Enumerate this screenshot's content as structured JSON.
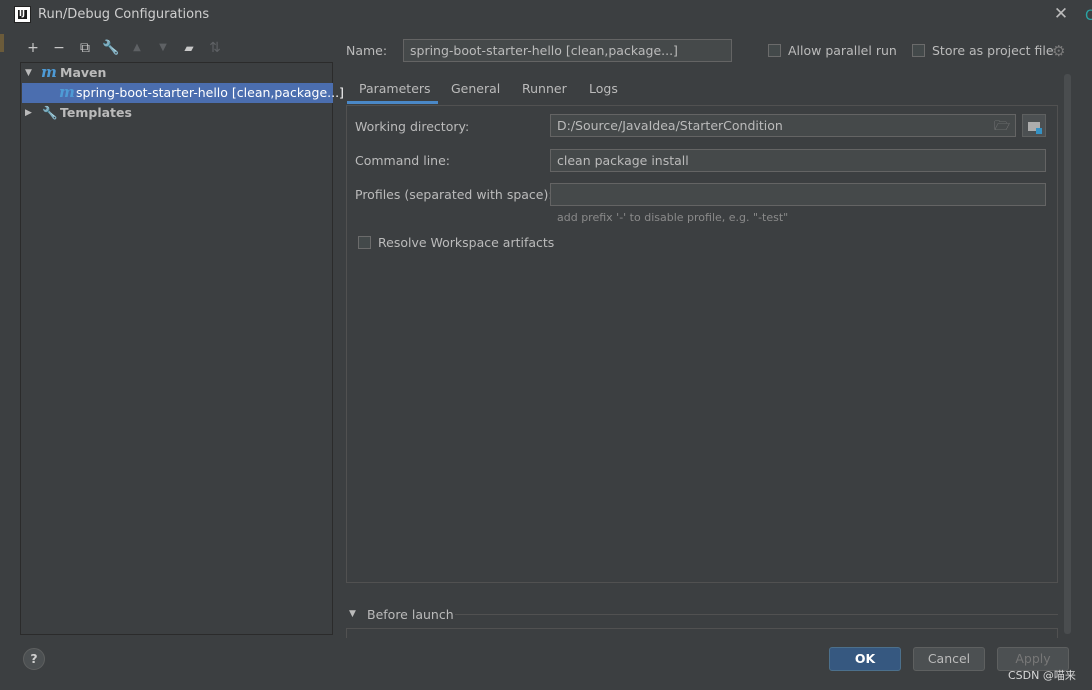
{
  "window": {
    "title": "Run/Debug Configurations",
    "app_icon_text": "IJ"
  },
  "toolbar": {
    "buttons": [
      {
        "name": "add",
        "glyph": "+"
      },
      {
        "name": "remove",
        "glyph": "−"
      },
      {
        "name": "copy",
        "glyph": "⧉"
      },
      {
        "name": "edit-defaults",
        "glyph": "🔧"
      },
      {
        "name": "move-up",
        "glyph": "▲"
      },
      {
        "name": "move-down",
        "glyph": "▼"
      },
      {
        "name": "new-folder",
        "glyph": "▰"
      },
      {
        "name": "sort",
        "glyph": "⇅"
      }
    ]
  },
  "tree": {
    "maven": {
      "label": "Maven",
      "icon": "m"
    },
    "config": {
      "label": "spring-boot-starter-hello [clean,package...]",
      "icon": "m"
    },
    "templates": {
      "label": "Templates"
    }
  },
  "form": {
    "name_label": "Name:",
    "name_value": "spring-boot-starter-hello [clean,package...]",
    "allow_parallel": "Allow parallel run",
    "store_project": "Store as project file",
    "tabs": [
      "Parameters",
      "General",
      "Runner",
      "Logs"
    ],
    "active_tab": "Parameters",
    "working_dir_label": "Working directory:",
    "working_dir_value": "D:/Source/JavaIdea/StarterCondition",
    "command_line_label": "Command line:",
    "command_line_value": "clean package install",
    "profiles_label": "Profiles (separated with space):",
    "profiles_value": "",
    "profiles_hint": "add prefix '-' to disable profile, e.g. \"-test\"",
    "resolve_workspace": "Resolve Workspace artifacts",
    "before_launch": "Before launch"
  },
  "buttons": {
    "ok": "OK",
    "cancel": "Cancel",
    "apply": "Apply",
    "help": "?"
  },
  "watermark": "CSDN @喵来",
  "colors": {
    "accent": "#4b6eaf",
    "primary_button": "#365880",
    "maven_icon": "#4e9bd6"
  }
}
